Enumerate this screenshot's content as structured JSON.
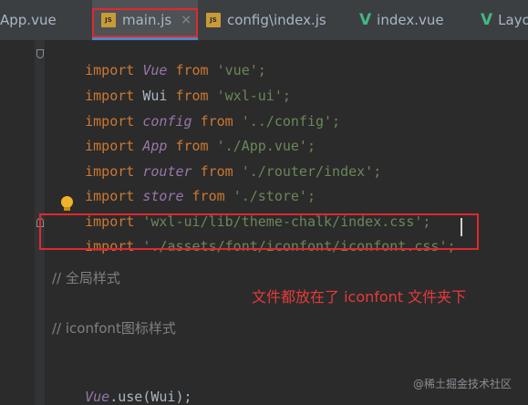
{
  "tabs": [
    {
      "label": "App.vue",
      "icon": "vue-file-icon"
    },
    {
      "label": "main.js",
      "icon": "js-file-icon",
      "icon_text": "JS",
      "close": "×",
      "active": true
    },
    {
      "label": "config\\index.js",
      "icon": "js-file-icon",
      "icon_text": "JS"
    },
    {
      "label": "index.vue",
      "icon": "vue-file-icon"
    },
    {
      "label": "Layo",
      "icon": "vue-file-icon"
    }
  ],
  "code": {
    "lines": [
      [
        "import",
        "Vue",
        "from",
        "'vue';"
      ],
      [
        "import",
        "Wui",
        "from",
        "'wxl-ui';"
      ],
      [
        "import",
        "config",
        "from",
        "'../config';"
      ],
      [
        "import",
        "App",
        "from",
        "'./App.vue';"
      ],
      [
        "import",
        "router",
        "from",
        "'./router/index';"
      ],
      [
        "import",
        "store",
        "from",
        "'./store';"
      ],
      [
        "import",
        "'wxl-ui/lib/theme-chalk/index.css';"
      ],
      [
        "import",
        "'./assets/font/iconfont/iconfont.css';"
      ]
    ],
    "comment_1": "// 全局样式",
    "comment_2": "// iconfont图标样式",
    "use_line": {
      "obj": "Vue",
      "rest": ".use(Wui);"
    }
  },
  "annotation": "文件都放在了 iconfont 文件夹下",
  "watermark": "@稀土掘金技术社区",
  "colors": {
    "background": "#2b2b2b",
    "keyword": "#cc7832",
    "string": "#6a8759",
    "identifier": "#9876aa",
    "comment": "#808080",
    "highlight_box": "#e0282f",
    "vue_icon": "#41b883",
    "js_icon": "#c89b38"
  }
}
